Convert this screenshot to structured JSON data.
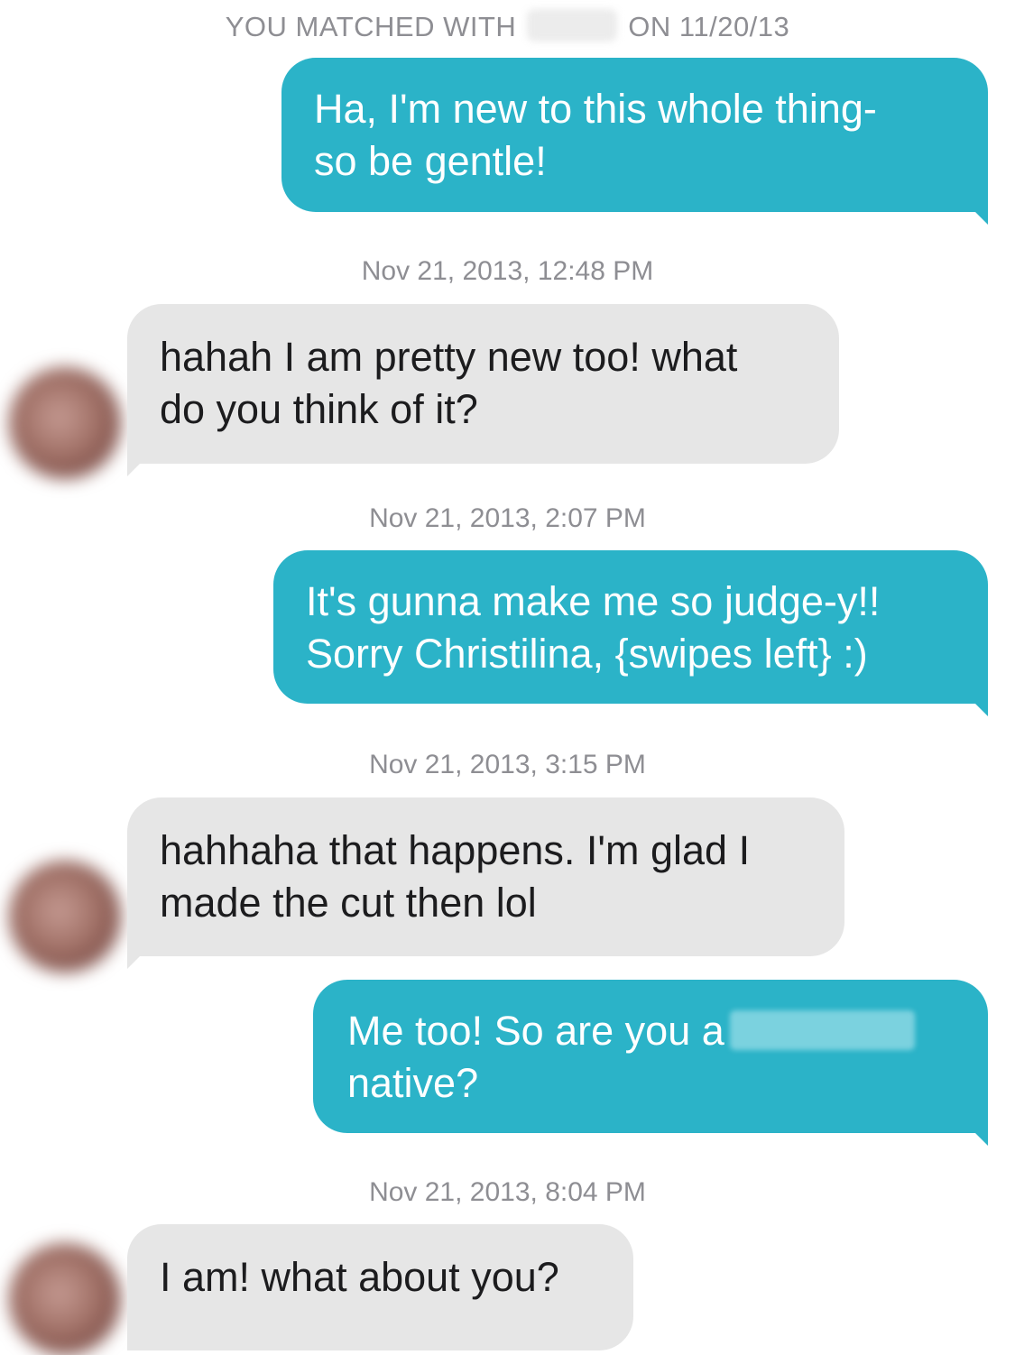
{
  "colors": {
    "sent_bubble": "#2bb3c8",
    "received_bubble": "#e6e6e6",
    "timestamp": "#8e8e93"
  },
  "header": {
    "prefix": "YOU MATCHED WITH",
    "suffix": "ON 11/20/13"
  },
  "messages": [
    {
      "lines": [
        "Ha, I'm new to this whole thing-",
        "so be gentle!"
      ]
    },
    {
      "time": "Nov 21, 2013, 12:48 PM",
      "lines": [
        "hahah I am pretty new too! what",
        "do you think of it?"
      ]
    },
    {
      "time": "Nov 21, 2013, 2:07 PM",
      "lines": [
        "It's gunna make me so judge-y!!",
        "Sorry Christilina, {swipes left} :)"
      ]
    },
    {
      "time": "Nov 21, 2013, 3:15 PM",
      "lines": [
        "hahhaha that happens. I'm glad I",
        "made the cut then lol"
      ]
    },
    {
      "lines": [
        "Me too! So are you a",
        "native?"
      ]
    },
    {
      "time": "Nov 21, 2013, 8:04 PM",
      "lines": [
        "I am! what about you?"
      ]
    }
  ]
}
